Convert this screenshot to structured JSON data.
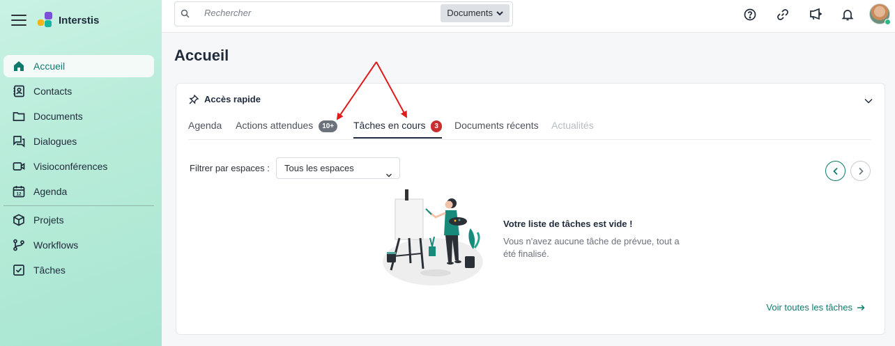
{
  "app": {
    "name": "Interstis"
  },
  "colors": {
    "accent": "#0d7a6c",
    "badge_grey": "#6c727c",
    "badge_red": "#c8302f",
    "annotation_arrow": "#e01b1b",
    "logo_purple": "#7b4fd6",
    "logo_teal": "#15b5a0",
    "logo_yellow": "#f5b31a"
  },
  "sidebar": {
    "menu_icon": "hamburger-icon",
    "items": [
      {
        "label": "Accueil",
        "icon": "home-icon",
        "active": true
      },
      {
        "label": "Contacts",
        "icon": "contacts-book-icon"
      },
      {
        "label": "Documents",
        "icon": "folder-icon"
      },
      {
        "label": "Dialogues",
        "icon": "chat-icon"
      },
      {
        "label": "Visioconférences",
        "icon": "video-camera-icon"
      },
      {
        "label": "Agenda",
        "icon": "calendar-icon"
      },
      {
        "label": "Projets",
        "icon": "cube-icon"
      },
      {
        "label": "Workflows",
        "icon": "branch-icon"
      },
      {
        "label": "Tâches",
        "icon": "checkbox-icon"
      }
    ]
  },
  "topbar": {
    "search_placeholder": "Rechercher",
    "search_scope": "Documents",
    "icons": [
      "help-icon",
      "link-icon",
      "megaphone-icon",
      "bell-icon"
    ]
  },
  "page": {
    "title": "Accueil"
  },
  "quick_access": {
    "title": "Accès rapide",
    "tabs": [
      {
        "label": "Agenda"
      },
      {
        "label": "Actions attendues",
        "badge": "10+"
      },
      {
        "label": "Tâches en cours",
        "badge": "3",
        "active": true
      },
      {
        "label": "Documents récents"
      },
      {
        "label": "Actualités",
        "disabled": true
      }
    ],
    "filter_label": "Filtrer par espaces :",
    "filter_value": "Tous les espaces",
    "empty_title": "Votre liste de tâches est vide !",
    "empty_description": "Vous n'avez aucune tâche de prévue, tout a été finalisé.",
    "see_all": "Voir toutes les tâches"
  }
}
